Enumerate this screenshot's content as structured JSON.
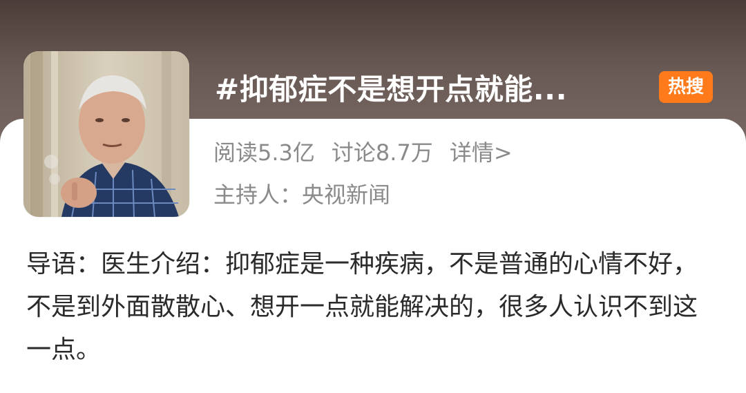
{
  "topic": {
    "title": "#抑郁症不是想开点就能...",
    "badge": "热搜",
    "stats": {
      "reads": "阅读5.3亿",
      "discussions": "讨论8.7万",
      "details_link": "详情>"
    },
    "host": "主持人：央视新闻",
    "intro": "导语：医生介绍：抑郁症是一种疾病，不是普通的心情不好，不是到外面散散心、想开一点就能解决的，很多人认识不到这一点。"
  },
  "colors": {
    "header_bg": "#4b3d39",
    "badge": "#ff7a1a",
    "secondary_text": "#8a8a8a",
    "body_text": "#2a2a2a"
  }
}
